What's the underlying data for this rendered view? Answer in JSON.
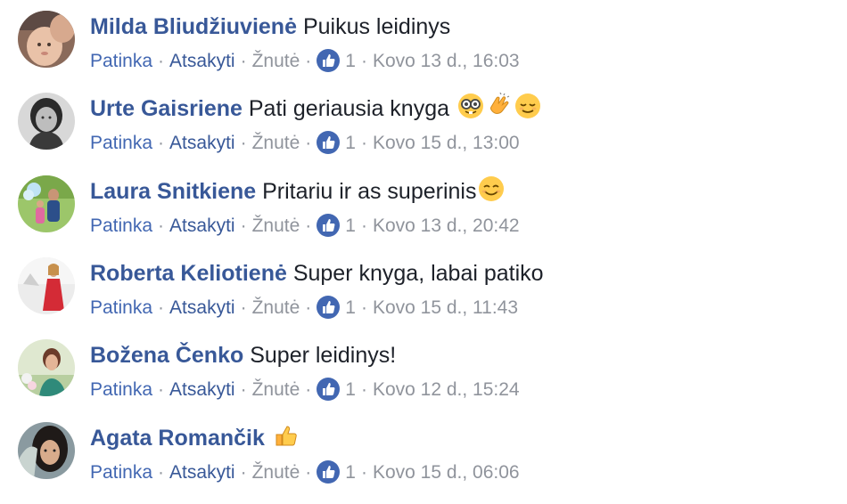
{
  "colors": {
    "author": "#385898",
    "like_link": "#4267b2",
    "muted": "#90949c",
    "like_badge": "#4267b2"
  },
  "comments": [
    {
      "author": "Milda Bliudžiuvienė",
      "text": "Puikus leidinys",
      "emoji": [],
      "like_label": "Patinka",
      "reply_label": "Atsakyti",
      "translate_label": "Žnutė",
      "like_count": "1",
      "timestamp": "Kovo 13 d., 16:03",
      "avatar_icon": "baby-photo-avatar"
    },
    {
      "author": "Urte Gaisriene",
      "text": "Pati geriausia knyga ",
      "emoji": [
        "nerd-face-emoji",
        "clapping-hands-emoji",
        "relieved-face-emoji"
      ],
      "like_label": "Patinka",
      "reply_label": "Atsakyti",
      "translate_label": "Žnutė",
      "like_count": "1",
      "timestamp": "Kovo 15 d., 13:00",
      "avatar_icon": "bw-portrait-avatar"
    },
    {
      "author": "Laura Snitkiene",
      "text": "Pritariu ir as superinis",
      "emoji": [
        "smiling-face-emoji"
      ],
      "like_label": "Patinka",
      "reply_label": "Atsakyti",
      "translate_label": "Žnutė",
      "like_count": "1",
      "timestamp": "Kovo 13 d., 20:42",
      "avatar_icon": "outdoor-photo-avatar"
    },
    {
      "author": "Roberta Keliotienė",
      "text": "Super knyga, labai patiko",
      "emoji": [],
      "like_label": "Patinka",
      "reply_label": "Atsakyti",
      "translate_label": "Žnutė",
      "like_count": "1",
      "timestamp": "Kovo 15 d., 11:43",
      "avatar_icon": "red-dress-avatar"
    },
    {
      "author": "Božena Čenko",
      "text": "Super leidinys!",
      "emoji": [],
      "like_label": "Patinka",
      "reply_label": "Atsakyti",
      "translate_label": "Žnutė",
      "like_count": "1",
      "timestamp": "Kovo 12 d., 15:24",
      "avatar_icon": "woman-flowers-avatar"
    },
    {
      "author": "Agata Romančik",
      "text": "",
      "emoji": [
        "thumbs-up-emoji"
      ],
      "like_label": "Patinka",
      "reply_label": "Atsakyti",
      "translate_label": "Žnutė",
      "like_count": "1",
      "timestamp": "Kovo 15 d., 06:06",
      "avatar_icon": "dark-hair-avatar"
    }
  ]
}
